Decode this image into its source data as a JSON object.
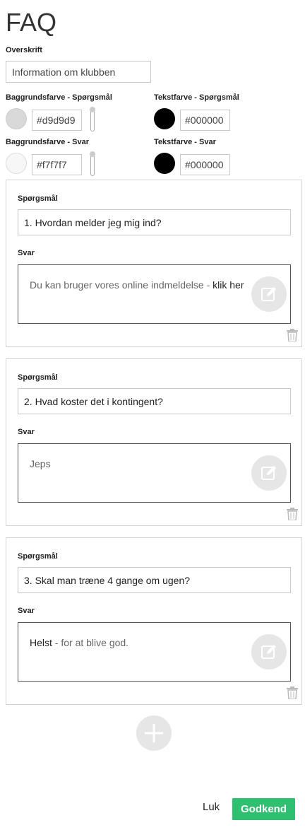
{
  "title": "FAQ",
  "heading": {
    "label": "Overskrift",
    "value": "Information om klubben"
  },
  "colors": {
    "question_bg": {
      "label": "Baggrundsfarve - Spørgsmål",
      "value": "#d9d9d9"
    },
    "question_text": {
      "label": "Tekstfarve - Spørgsmål",
      "value": "#000000"
    },
    "answer_bg": {
      "label": "Baggrundsfarve - Svar",
      "value": "#f7f7f7"
    },
    "answer_text": {
      "label": "Tekstfarve - Svar",
      "value": "#000000"
    }
  },
  "faq_items": [
    {
      "question_label": "Spørgsmål",
      "question": "1. Hvordan melder jeg mig ind?",
      "answer_label": "Svar",
      "answer_part1": "Du kan bruger vores online indmeldelse - ",
      "answer_part2": "klik her"
    },
    {
      "question_label": "Spørgsmål",
      "question": "2. Hvad koster det i kontingent?",
      "answer_label": "Svar",
      "answer_part1": "Jeps",
      "answer_part2": ""
    },
    {
      "question_label": "Spørgsmål",
      "question": "3. Skal man træne 4 gange om ugen?",
      "answer_label": "Svar",
      "answer_part1": "Helst",
      "answer_part2": " - for at blive god."
    }
  ],
  "icons": {
    "edit": "edit-icon",
    "trash": "trash-icon",
    "add": "plus-icon"
  },
  "footer": {
    "close_label": "Luk",
    "approve_label": "Godkend"
  },
  "accent_color": "#2fbf71"
}
